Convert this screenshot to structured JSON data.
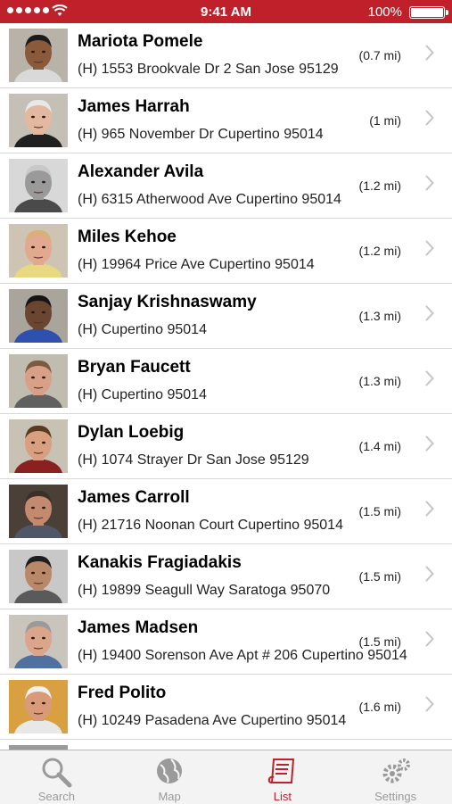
{
  "status_bar": {
    "time": "9:41 AM",
    "battery": "100%"
  },
  "rows": [
    {
      "name": "Mariota Pomele",
      "address": "(H) 1553 Brookvale Dr 2 San Jose 95129",
      "distance": "(0.7 mi)",
      "skin": "#8a5a3a",
      "hair": "#1a1a1a",
      "bg": "#b8b2a8",
      "shirt": "#d9d9d9"
    },
    {
      "name": "James Harrah",
      "address": "(H) 965 November Dr Cupertino 95014",
      "distance": "(1 mi)",
      "skin": "#e3b8a0",
      "hair": "#e8e8e8",
      "bg": "#c5c0b5",
      "shirt": "#202020"
    },
    {
      "name": "Alexander Avila",
      "address": "(H) 6315 Atherwood Ave Cupertino 95014",
      "distance": "(1.2 mi)",
      "skin": "#9a9a9a",
      "hair": "#c8c8c8",
      "bg": "#d8d8d8",
      "shirt": "#4a4a4a"
    },
    {
      "name": "Miles Kehoe",
      "address": "(H) 19964 Price Ave Cupertino 95014",
      "distance": "(1.2 mi)",
      "skin": "#e3a890",
      "hair": "#d9b07a",
      "bg": "#cdc4b4",
      "shirt": "#e8d880"
    },
    {
      "name": "Sanjay Krishnaswamy",
      "address": "(H)  Cupertino 95014",
      "distance": "(1.3 mi)",
      "skin": "#6a4530",
      "hair": "#151515",
      "bg": "#a9a49c",
      "shirt": "#3050b0"
    },
    {
      "name": "Bryan Faucett",
      "address": "(H)  Cupertino 95014",
      "distance": "(1.3 mi)",
      "skin": "#d9a088",
      "hair": "#7a5a40",
      "bg": "#c0bcb0",
      "shirt": "#606060"
    },
    {
      "name": "Dylan Loebig",
      "address": "(H) 1074 Strayer Dr San Jose 95129",
      "distance": "(1.4 mi)",
      "skin": "#d8a080",
      "hair": "#5a3a20",
      "bg": "#c7c2b4",
      "shirt": "#8a2020"
    },
    {
      "name": "James Carroll",
      "address": "(H) 21716 Noonan Court Cupertino 95014",
      "distance": "(1.5 mi)",
      "skin": "#c48a70",
      "hair": "#3a3028",
      "bg": "#4a4038",
      "shirt": "#505868"
    },
    {
      "name": "Kanakis Fragiadakis",
      "address": "(H) 19899 Seagull Way Saratoga 95070",
      "distance": "(1.5 mi)",
      "skin": "#b88868",
      "hair": "#1e1e1e",
      "bg": "#c8c8c8",
      "shirt": "#5a5a5a"
    },
    {
      "name": "James Madsen",
      "address": "(H) 19400 Sorenson Ave Apt # 206 Cupertino 95014",
      "distance": "(1.5 mi)",
      "skin": "#dba58c",
      "hair": "#9a9a9a",
      "bg": "#c9c5bc",
      "shirt": "#5070a0"
    },
    {
      "name": "Fred Polito",
      "address": "(H) 10249 Pasadena Ave Cupertino 95014",
      "distance": "(1.6 mi)",
      "skin": "#d89a78",
      "hair": "#f0f0f0",
      "bg": "#d8a040",
      "shirt": "#e8e8e8"
    }
  ],
  "tabs": [
    {
      "label": "Search",
      "icon": "magnifier-icon",
      "active": false
    },
    {
      "label": "Map",
      "icon": "globe-icon",
      "active": false
    },
    {
      "label": "List",
      "icon": "scroll-list-icon",
      "active": true
    },
    {
      "label": "Settings",
      "icon": "gears-icon",
      "active": false
    }
  ],
  "colors": {
    "accent": "#c0202a",
    "tab_inactive": "#9a9a9a"
  }
}
